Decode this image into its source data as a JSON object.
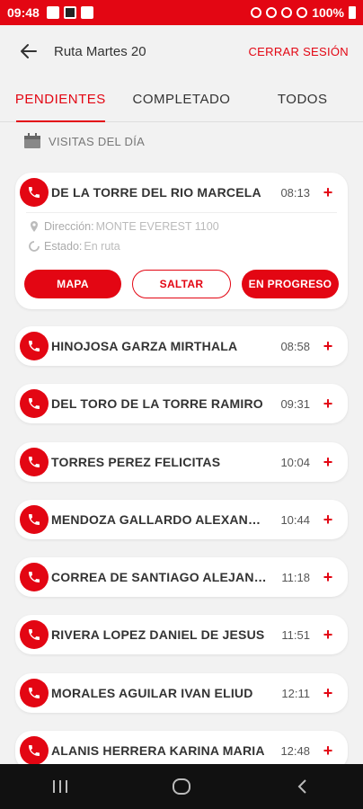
{
  "statusbar": {
    "time": "09:48",
    "battery": "100%"
  },
  "appbar": {
    "title": "Ruta Martes 20",
    "logout_label": "CERRAR SESIÓN"
  },
  "tabs": [
    {
      "label": "PENDIENTES",
      "active": true
    },
    {
      "label": "COMPLETADO",
      "active": false
    },
    {
      "label": "TODOS",
      "active": false
    }
  ],
  "section": {
    "title": "VISITAS DEL DÍA"
  },
  "expanded_visit": {
    "name": "DE LA TORRE DEL RIO MARCELA",
    "time": "08:13",
    "address_label": "Dirección:",
    "address_value": "MONTE EVEREST 1100",
    "status_label": "Estado:",
    "status_value": "En ruta",
    "buttons": {
      "map": "MAPA",
      "skip": "SALTAR",
      "progress": "EN PROGRESO"
    }
  },
  "visits": [
    {
      "name": "HINOJOSA GARZA MIRTHALA",
      "time": "08:58"
    },
    {
      "name": "DEL TORO DE LA TORRE RAMIRO",
      "time": "09:31"
    },
    {
      "name": "TORRES PEREZ FELICITAS",
      "time": "10:04"
    },
    {
      "name": "MENDOZA GALLARDO ALEXANDRA",
      "time": "10:44"
    },
    {
      "name": "CORREA DE SANTIAGO ALEJANDRA",
      "time": "11:18"
    },
    {
      "name": "RIVERA LOPEZ DANIEL DE JESUS",
      "time": "11:51"
    },
    {
      "name": "MORALES AGUILAR IVAN ELIUD",
      "time": "12:11"
    },
    {
      "name": "ALANIS HERRERA KARINA MARIA",
      "time": "12:48"
    }
  ],
  "colors": {
    "accent": "#e30613",
    "background": "#f2f2f2"
  },
  "icons": {
    "back": "arrow-left-icon",
    "phone": "phone-icon",
    "add": "plus-icon",
    "calendar": "calendar-icon"
  }
}
